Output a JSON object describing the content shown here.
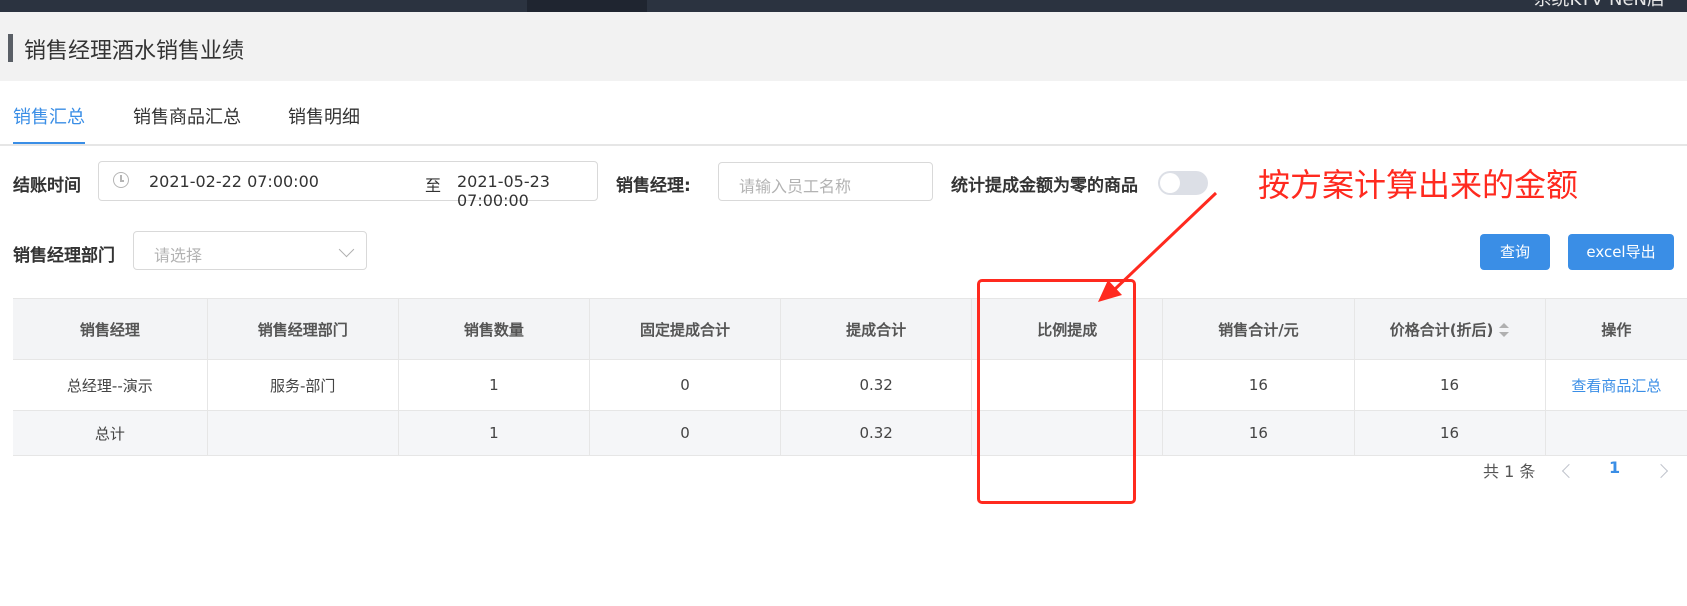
{
  "topbar": {
    "right_text": "系统KTV NeN店"
  },
  "page": {
    "title": "销售经理酒水销售业绩"
  },
  "tabs": [
    {
      "label": "销售汇总",
      "active": true
    },
    {
      "label": "销售商品汇总",
      "active": false
    },
    {
      "label": "销售明细",
      "active": false
    }
  ],
  "filters": {
    "checkout_time_label": "结账时间",
    "date_start": "2021-02-22 07:00:00",
    "date_sep": "至",
    "date_end": "2021-05-23 07:00:00",
    "manager_label": "销售经理:",
    "manager_placeholder": "请输入员工名称",
    "zero_commission_label": "统计提成金额为零的商品",
    "zero_commission_on": false,
    "dept_label": "销售经理部门",
    "dept_placeholder": "请选择"
  },
  "buttons": {
    "query": "查询",
    "export": "excel导出"
  },
  "table": {
    "columns": [
      "销售经理",
      "销售经理部门",
      "销售数量",
      "固定提成合计",
      "提成合计",
      "比例提成",
      "销售合计/元",
      "价格合计(折后)",
      "操作"
    ],
    "rows": [
      {
        "manager": "总经理--演示",
        "dept": "服务-部门",
        "qty": "1",
        "fixed": "0",
        "commission": "0.32",
        "ratio": "",
        "sales": "16",
        "price": "16",
        "action": "查看商品汇总"
      }
    ],
    "total": {
      "manager": "总计",
      "dept": "",
      "qty": "1",
      "fixed": "0",
      "commission": "0.32",
      "ratio": "",
      "sales": "16",
      "price": "16",
      "action": ""
    }
  },
  "pager": {
    "total_text": "共 1 条",
    "current": "1"
  },
  "annotation": {
    "text": "按方案计算出来的金额",
    "color": "#ff2a1f"
  }
}
